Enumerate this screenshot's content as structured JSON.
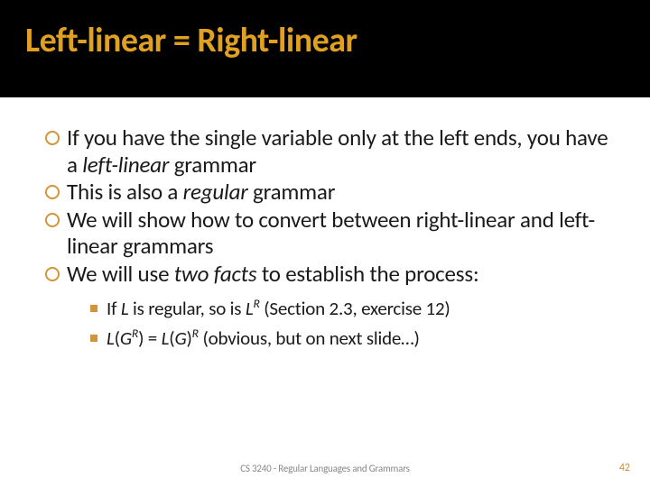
{
  "title": "Left-linear = Right-linear",
  "bullets": [
    {
      "pre": "If you have the single variable only at the left ends, you have a ",
      "em": "left-linear",
      "post": " grammar"
    },
    {
      "pre": "This is also a ",
      "em": "regular",
      "post": " grammar"
    },
    {
      "pre": "We will show how to convert between right-linear and left-linear grammars",
      "em": "",
      "post": ""
    },
    {
      "pre": "We will use ",
      "em": "two facts",
      "post": " to establish the process:"
    }
  ],
  "subbullets": [
    {
      "t0": "If ",
      "i0": "L",
      "t1": " is regular, so is ",
      "i1": "L",
      "sup1": "R",
      "t2": " (Section 2.3, exercise 12)"
    },
    {
      "i0": "L",
      "t0": "(",
      "i1": "G",
      "sup1": "R",
      "t1": ") = ",
      "i2": "L",
      "t2": "(",
      "i3": "G",
      "t3": ")",
      "sup3": "R",
      "t4": " (obvious, but on next slide…)"
    }
  ],
  "footer": "CS 3240 - Regular Languages and Grammars",
  "page": "42"
}
